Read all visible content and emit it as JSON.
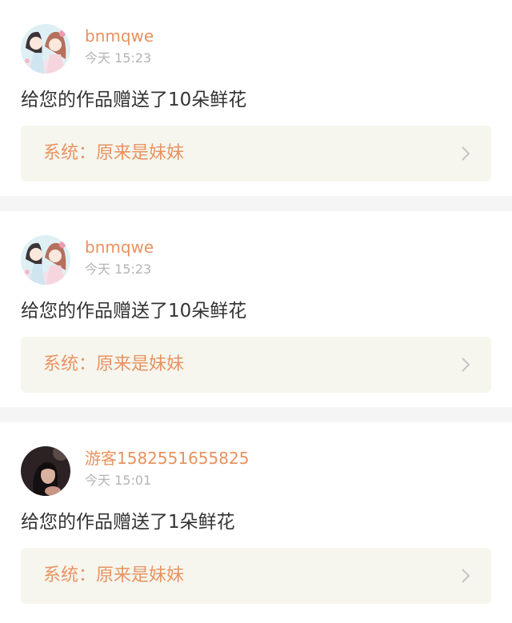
{
  "feed": [
    {
      "user": "bnmqwe",
      "time": "今天 15:23",
      "message": "给您的作品赠送了10朵鲜花",
      "work_title": "系统：原来是妹妹",
      "avatar": "anime-girls-avatar"
    },
    {
      "user": "bnmqwe",
      "time": "今天 15:23",
      "message": "给您的作品赠送了10朵鲜花",
      "work_title": "系统：原来是妹妹",
      "avatar": "anime-girls-avatar"
    },
    {
      "user": "游客1582551655825",
      "time": "今天 15:01",
      "message": "给您的作品赠送了1朵鲜花",
      "work_title": "系统：原来是妹妹",
      "avatar": "photo-portrait-avatar"
    }
  ],
  "colors": {
    "accent": "#e8925e",
    "work_bg": "#f6f6ee",
    "divider": "#f5f5f5"
  }
}
